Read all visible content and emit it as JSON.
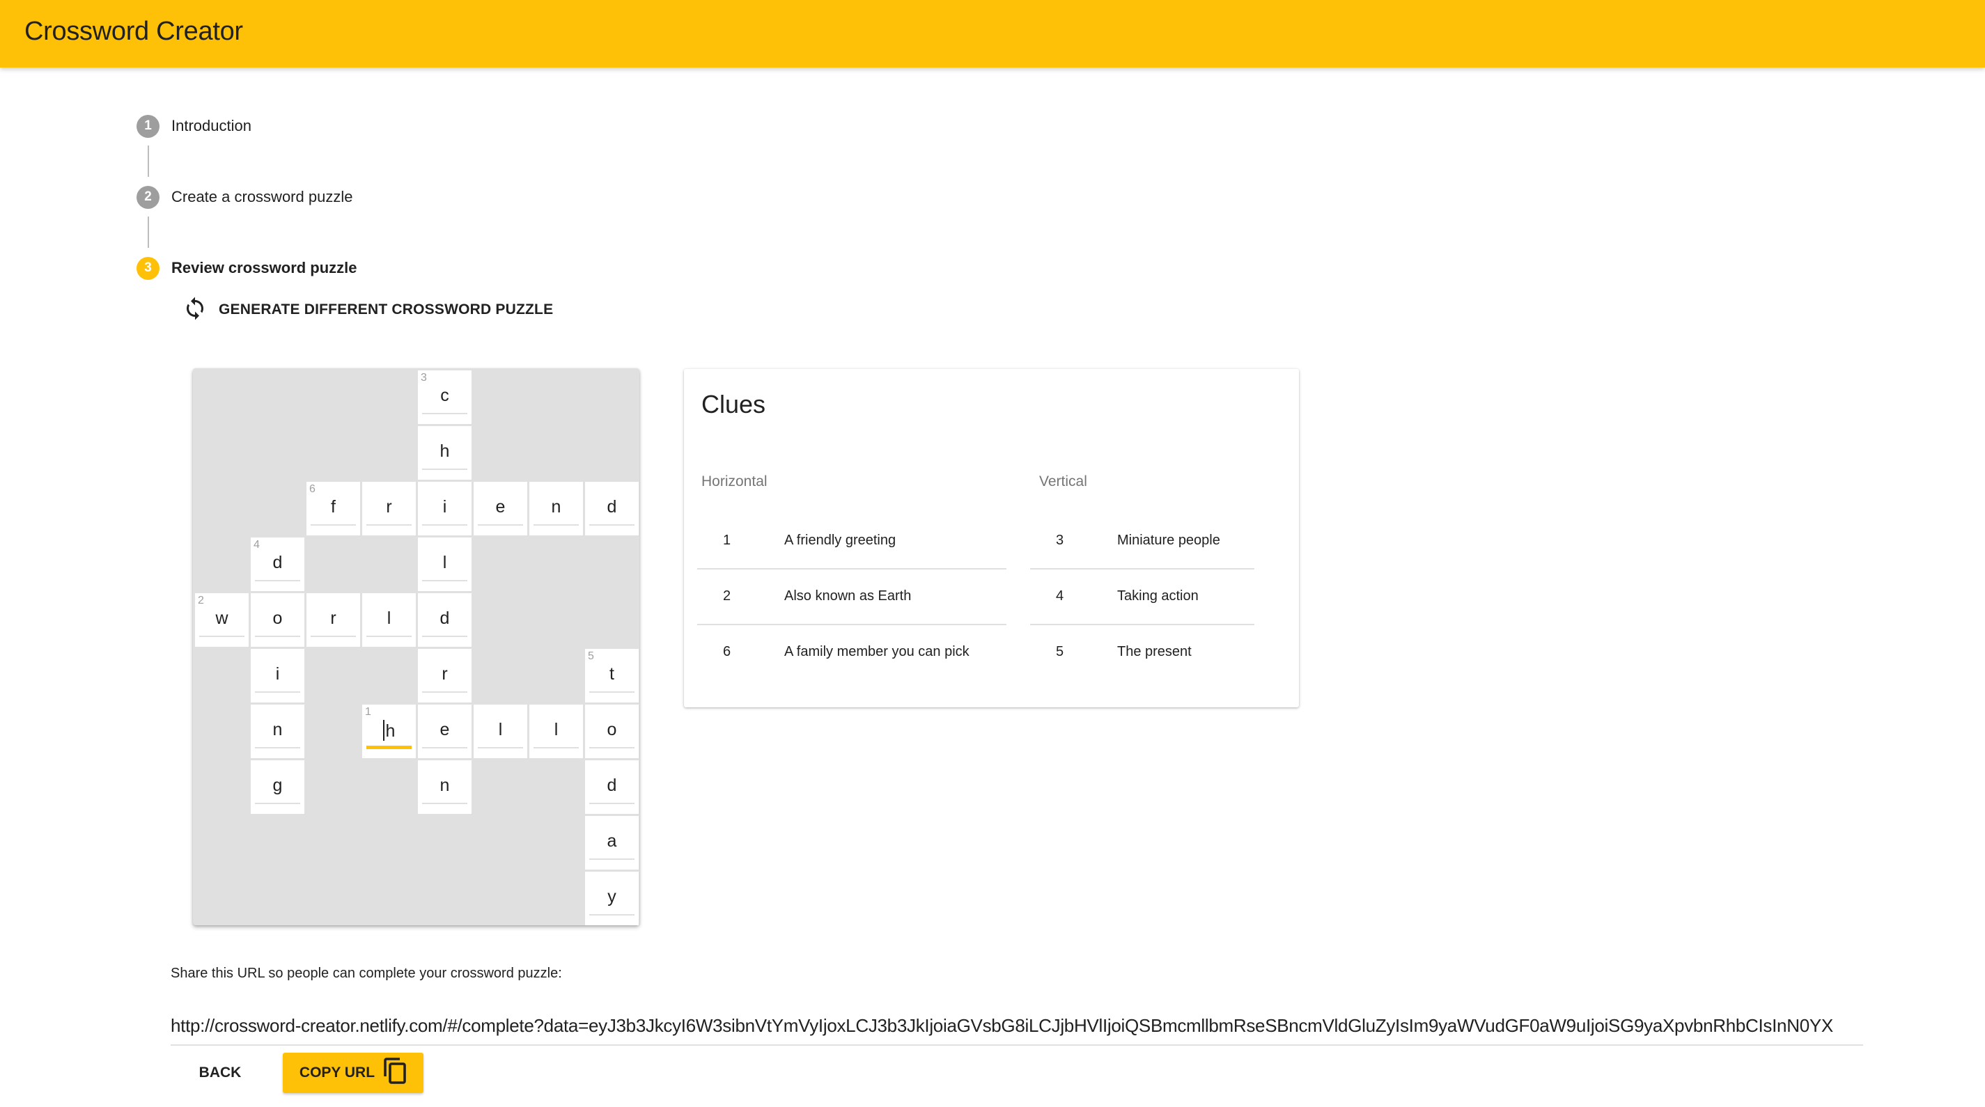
{
  "app": {
    "title": "Crossword Creator",
    "accent_color": "#FFC107"
  },
  "stepper": {
    "steps": [
      {
        "number": "1",
        "label": "Introduction",
        "state": "completed"
      },
      {
        "number": "2",
        "label": "Create a crossword puzzle",
        "state": "completed"
      },
      {
        "number": "3",
        "label": "Review crossword puzzle",
        "state": "active"
      }
    ],
    "generate_button": {
      "label": "GENERATE DIFFERENT CROSSWORD PUZZLE",
      "icon": "refresh-icon"
    }
  },
  "crossword": {
    "columns": 8,
    "rows": 10,
    "focused_cell": {
      "row": 6,
      "col": 3
    },
    "cells": [
      {
        "row": 0,
        "col": 4,
        "letter": "c",
        "number": "3"
      },
      {
        "row": 1,
        "col": 4,
        "letter": "h"
      },
      {
        "row": 2,
        "col": 2,
        "letter": "f",
        "number": "6"
      },
      {
        "row": 2,
        "col": 3,
        "letter": "r"
      },
      {
        "row": 2,
        "col": 4,
        "letter": "i"
      },
      {
        "row": 2,
        "col": 5,
        "letter": "e"
      },
      {
        "row": 2,
        "col": 6,
        "letter": "n"
      },
      {
        "row": 2,
        "col": 7,
        "letter": "d"
      },
      {
        "row": 3,
        "col": 1,
        "letter": "d",
        "number": "4"
      },
      {
        "row": 3,
        "col": 4,
        "letter": "l"
      },
      {
        "row": 4,
        "col": 0,
        "letter": "w",
        "number": "2"
      },
      {
        "row": 4,
        "col": 1,
        "letter": "o"
      },
      {
        "row": 4,
        "col": 2,
        "letter": "r"
      },
      {
        "row": 4,
        "col": 3,
        "letter": "l"
      },
      {
        "row": 4,
        "col": 4,
        "letter": "d"
      },
      {
        "row": 5,
        "col": 1,
        "letter": "i"
      },
      {
        "row": 5,
        "col": 4,
        "letter": "r"
      },
      {
        "row": 5,
        "col": 7,
        "letter": "t",
        "number": "5"
      },
      {
        "row": 6,
        "col": 1,
        "letter": "n"
      },
      {
        "row": 6,
        "col": 3,
        "letter": "h",
        "number": "1"
      },
      {
        "row": 6,
        "col": 4,
        "letter": "e"
      },
      {
        "row": 6,
        "col": 5,
        "letter": "l"
      },
      {
        "row": 6,
        "col": 6,
        "letter": "l"
      },
      {
        "row": 6,
        "col": 7,
        "letter": "o"
      },
      {
        "row": 7,
        "col": 1,
        "letter": "g"
      },
      {
        "row": 7,
        "col": 4,
        "letter": "n"
      },
      {
        "row": 7,
        "col": 7,
        "letter": "d"
      },
      {
        "row": 8,
        "col": 7,
        "letter": "a"
      },
      {
        "row": 9,
        "col": 7,
        "letter": "y"
      }
    ]
  },
  "clues": {
    "title": "Clues",
    "horizontal": {
      "heading": "Horizontal",
      "items": [
        {
          "number": "1",
          "text": "A friendly greeting"
        },
        {
          "number": "2",
          "text": "Also known as Earth"
        },
        {
          "number": "6",
          "text": "A family member you can pick"
        }
      ]
    },
    "vertical": {
      "heading": "Vertical",
      "items": [
        {
          "number": "3",
          "text": "Miniature people"
        },
        {
          "number": "4",
          "text": "Taking action"
        },
        {
          "number": "5",
          "text": "The present"
        }
      ]
    }
  },
  "share": {
    "label": "Share this URL so people can complete your crossword puzzle:",
    "url": "http://crossword-creator.netlify.com/#/complete?data=eyJ3b3JkcyI6W3sibnVtYmVyIjoxLCJ3b3JkIjoiaGVsbG8iLCJjbHVlIjoiQSBmcmllbmRseSBncmVldGluZyIsIm9yaWVudGF0aW9uIjoiSG9yaXpvbnRhbCIsInN0YX"
  },
  "actions": {
    "back_label": "BACK",
    "copy_label": "COPY URL",
    "copy_icon": "copy-icon"
  }
}
